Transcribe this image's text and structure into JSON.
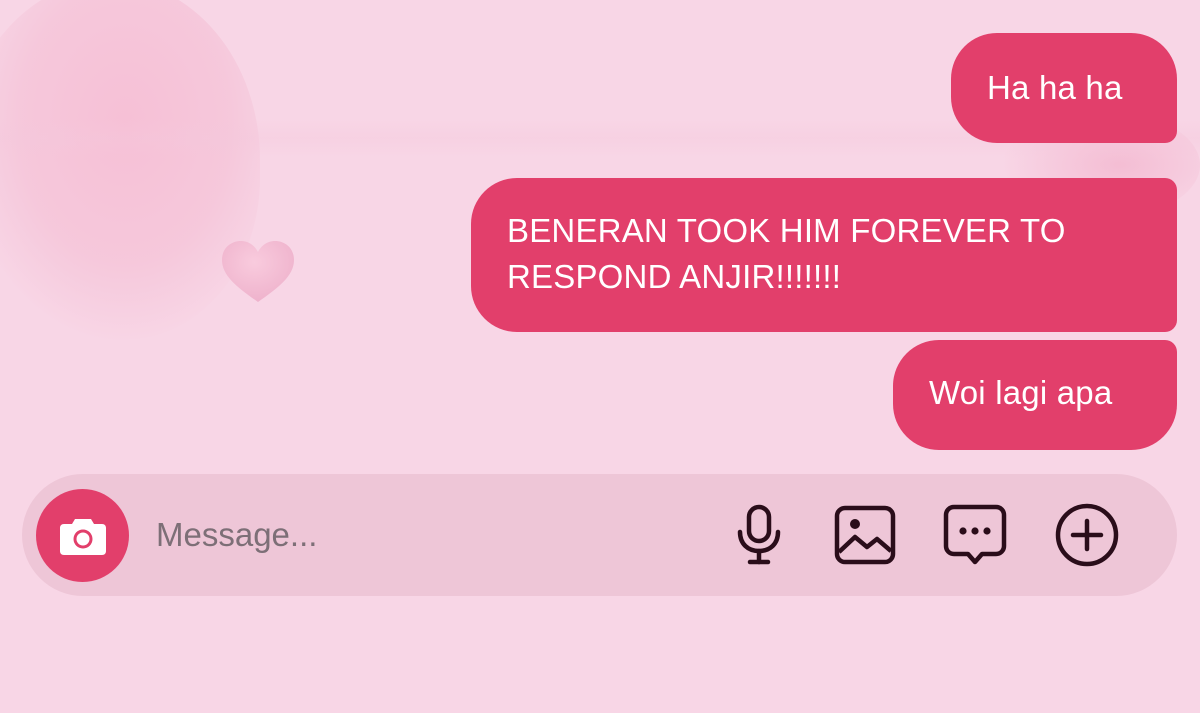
{
  "colors": {
    "background": "#f8d6e6",
    "bubble": "#e23f6b",
    "bubble_text": "#ffffff",
    "composer": "#eec6d7",
    "icon": "#2a0d1a",
    "placeholder": "#7d6f77"
  },
  "messages": [
    {
      "text": "Ha ha ha",
      "sender": "me"
    },
    {
      "text": "BENERAN TOOK HIM FOREVER TO RESPOND ANJIR!!!!!!!",
      "sender": "me"
    },
    {
      "text": "Woi lagi apa",
      "sender": "me"
    }
  ],
  "composer": {
    "placeholder": "Message...",
    "value": "",
    "buttons": [
      {
        "name": "camera",
        "icon": "camera-icon"
      },
      {
        "name": "voice",
        "icon": "microphone-icon"
      },
      {
        "name": "gallery",
        "icon": "image-icon"
      },
      {
        "name": "sticker",
        "icon": "chat-bubble-dots-icon"
      },
      {
        "name": "more",
        "icon": "plus-circle-icon"
      }
    ]
  }
}
